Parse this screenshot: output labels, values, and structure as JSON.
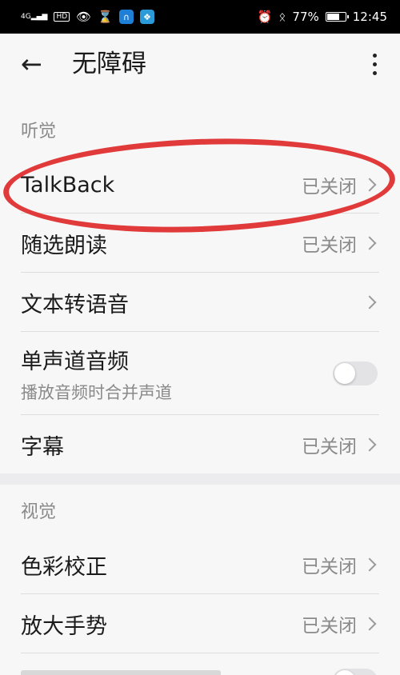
{
  "status_bar": {
    "signal_text": "4G",
    "hd_text": "HD",
    "battery_percent": "77%",
    "battery_level": 0.77,
    "time": "12:45",
    "icons": [
      "signal-icon",
      "hd-icon",
      "eye-icon",
      "hourglass-icon",
      "app-icon",
      "app2-icon",
      "alarm-icon",
      "bluetooth-icon",
      "battery-icon"
    ]
  },
  "header": {
    "back_glyph": "←",
    "title": "无障碍"
  },
  "sections": {
    "hearing": {
      "label": "听觉"
    },
    "vision": {
      "label": "视觉"
    }
  },
  "items": {
    "talkback": {
      "label": "TalkBack",
      "status": "已关闭"
    },
    "select_to_speak": {
      "label": "随选朗读",
      "status": "已关闭"
    },
    "tts": {
      "label": "文本转语音"
    },
    "mono_audio": {
      "label": "单声道音频",
      "subtitle": "播放音频时合并声道",
      "enabled": false
    },
    "captions": {
      "label": "字幕",
      "status": "已关闭"
    },
    "color_correction": {
      "label": "色彩校正",
      "status": "已关闭"
    },
    "magnification": {
      "label": "放大手势",
      "status": "已关闭"
    }
  },
  "annotation_color": "#e13a3a"
}
